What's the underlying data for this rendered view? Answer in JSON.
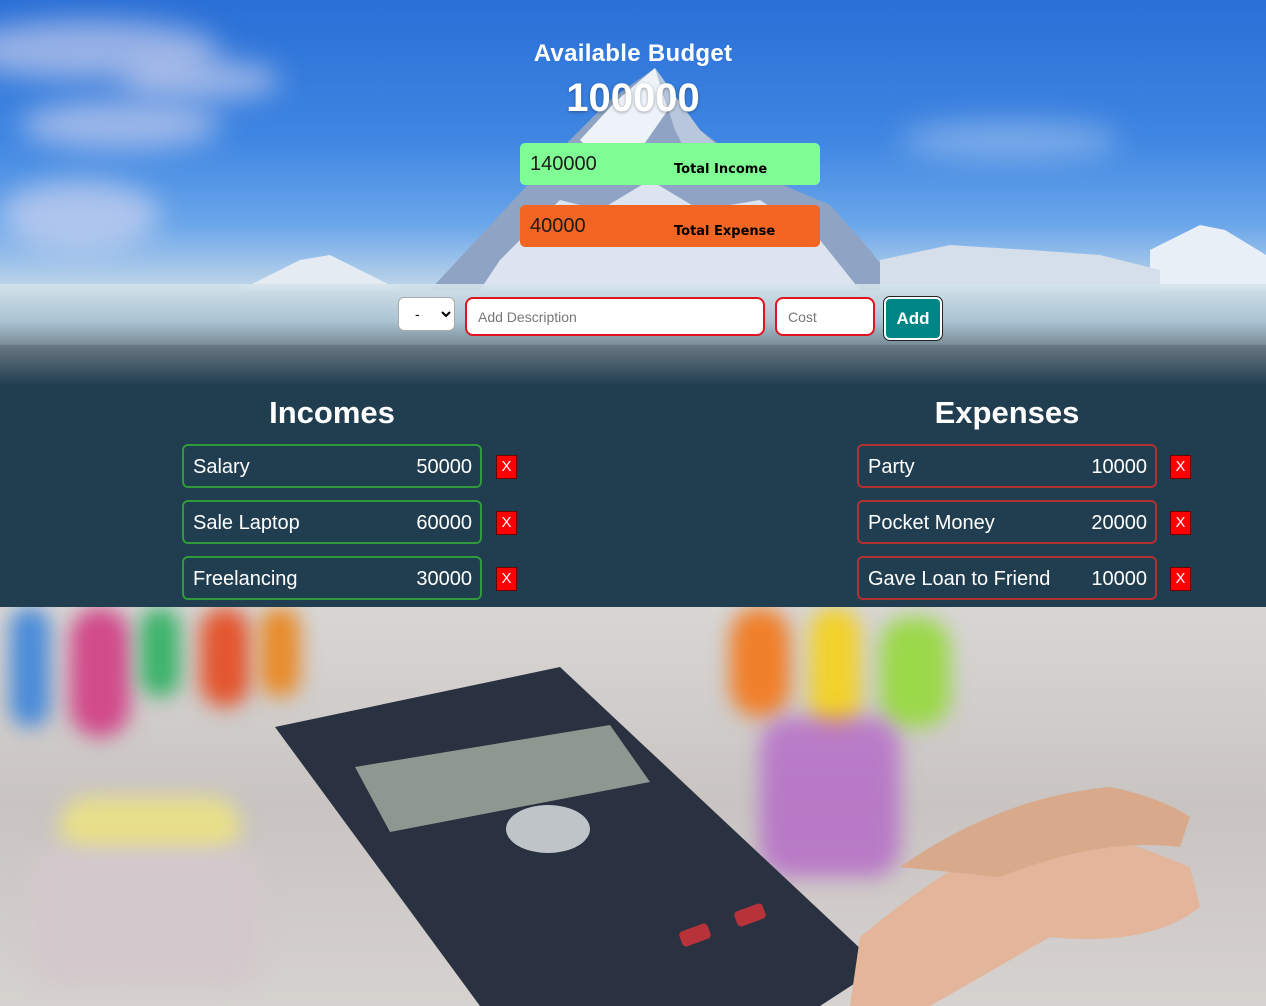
{
  "budget": {
    "title": "Available Budget",
    "value": "100000",
    "total_income_amount": "140000",
    "total_income_label": "Total Income",
    "total_expense_amount": "40000",
    "total_expense_label": "Total Expense"
  },
  "form": {
    "type_selected": "-",
    "description_placeholder": "Add Description",
    "cost_placeholder": "Cost",
    "add_label": "Add"
  },
  "incomes": {
    "title": "Incomes",
    "items": [
      {
        "description": "Salary",
        "amount": "50000"
      },
      {
        "description": "Sale Laptop",
        "amount": "60000"
      },
      {
        "description": "Freelancing",
        "amount": "30000"
      }
    ]
  },
  "expenses": {
    "title": "Expenses",
    "items": [
      {
        "description": "Party",
        "amount": "10000"
      },
      {
        "description": "Pocket Money",
        "amount": "20000"
      },
      {
        "description": "Gave Loan to Friend",
        "amount": "10000"
      }
    ]
  },
  "delete_label": "X",
  "colors": {
    "income_box": "#80fc94",
    "expense_box": "#f26522",
    "list_background": "#213e50",
    "add_button": "#008587",
    "delete_button": "#ff0000",
    "income_border": "#2e9a3c",
    "expense_border": "#b03030"
  }
}
